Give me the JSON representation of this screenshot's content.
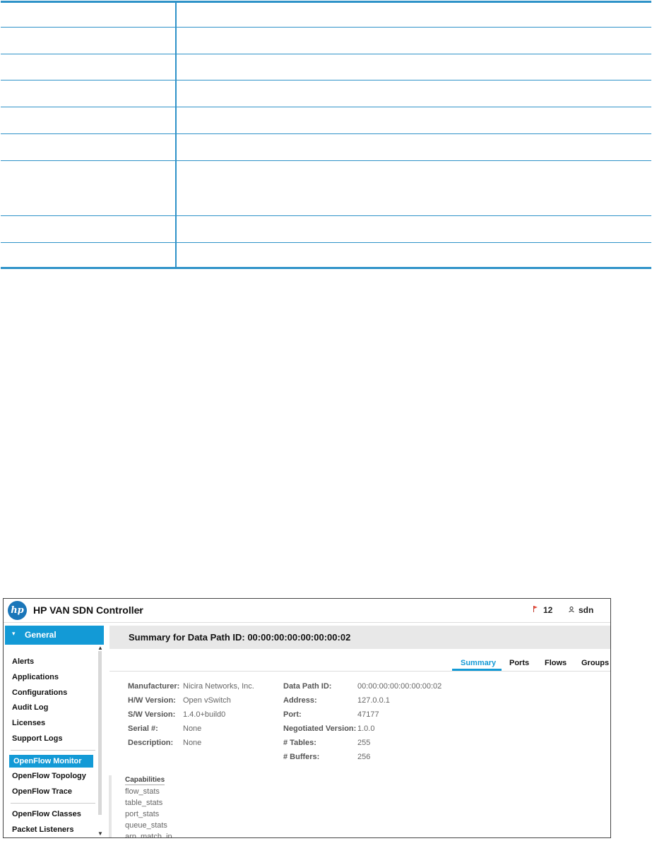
{
  "app": {
    "title": "HP VAN SDN Controller",
    "logo_text": "hp",
    "alert_count": "12",
    "user": "sdn",
    "accent_color": "#139ad6"
  },
  "sidebar": {
    "section": "General",
    "items": [
      "Alerts",
      "Applications",
      "Configurations",
      "Audit Log",
      "Licenses",
      "Support Logs",
      "OpenFlow Monitor",
      "OpenFlow Topology",
      "OpenFlow Trace",
      "OpenFlow Classes",
      "Packet Listeners"
    ],
    "active": "OpenFlow Monitor"
  },
  "summary": {
    "title": "Summary for Data Path ID: 00:00:00:00:00:00:00:02"
  },
  "tabs": [
    "Summary",
    "Ports",
    "Flows",
    "Groups"
  ],
  "active_tab": "Summary",
  "details_left": [
    {
      "key": "Manufacturer:",
      "value": "Nicira Networks, Inc."
    },
    {
      "key": "H/W Version:",
      "value": "Open vSwitch"
    },
    {
      "key": "S/W Version:",
      "value": "1.4.0+build0"
    },
    {
      "key": "Serial #:",
      "value": "None"
    },
    {
      "key": "Description:",
      "value": "None"
    }
  ],
  "details_right": [
    {
      "key": "Data Path ID:",
      "value": "00:00:00:00:00:00:00:02"
    },
    {
      "key": "Address:",
      "value": "127.0.0.1"
    },
    {
      "key": "Port:",
      "value": "47177"
    },
    {
      "key": "Negotiated Version:",
      "value": "1.0.0"
    },
    {
      "key": "# Tables:",
      "value": "255"
    },
    {
      "key": "# Buffers:",
      "value": "256"
    }
  ],
  "capabilities": {
    "title": "Capabilities",
    "items": [
      "flow_stats",
      "table_stats",
      "port_stats",
      "queue_stats",
      "arp_match_ip"
    ]
  }
}
